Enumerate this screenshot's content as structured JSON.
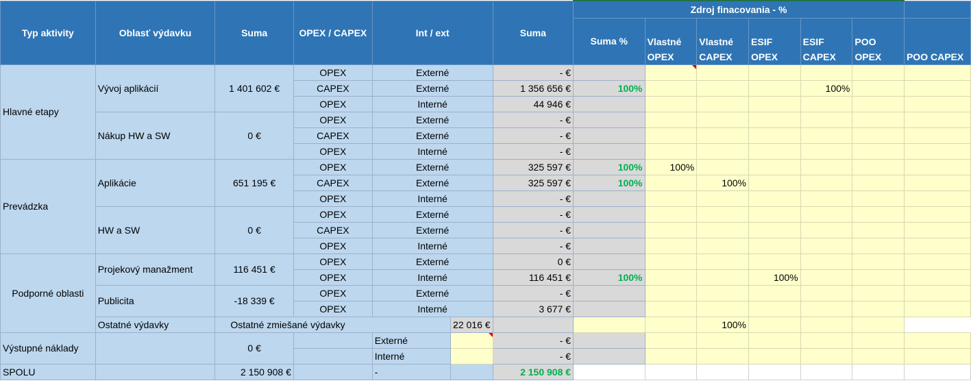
{
  "header": {
    "typ_aktivity": "Typ aktivity",
    "oblast_vydavku": "Oblasť výdavku",
    "suma": "Suma",
    "opex_capex": "OPEX / CAPEX",
    "int_ext": "Int / ext",
    "suma2": "Suma",
    "zdroj": "Zdroj finacovania - %",
    "suma_pct": "Suma %",
    "vlastne_opex": "Vlastné OPEX",
    "vlastne_capex": "Vlastné CAPEX",
    "esif_opex": "ESIF OPEX",
    "esif_capex": "ESIF CAPEX",
    "poo_opex": "POO OPEX",
    "poo_capex": "POO CAPEX"
  },
  "groups": {
    "hlavne": "Hlavné etapy",
    "prevadzka": "Prevádzka",
    "podporne": "Podporné oblasti",
    "vystupne": "Výstupné náklady",
    "spolu": "SPOLU"
  },
  "areas": {
    "vyvoj": "Vývoj aplikácií",
    "vyvoj_sum": "1 401 602 €",
    "nakup": "Nákup HW a SW",
    "nakup_sum": "0 €",
    "aplikacie": "Aplikácie",
    "aplikacie_sum": "651 195 €",
    "hwsw": "HW a SW",
    "hwsw_sum": "0 €",
    "projekt": "Projekový manažment",
    "projekt_sum": "116 451 €",
    "publicita": "Publicita",
    "publicita_sum": "-18 339 €",
    "ostatne": "Ostatné výdavky",
    "ostatne_mix": "Ostatné zmiešané výdavky",
    "ostatne_dash": "-",
    "ostatne_sum": "22 016 €",
    "ostatne_esif": "100%",
    "vystupne_sum": "0 €",
    "vyst_ext": "Externé",
    "vyst_int": "Interné",
    "vyst_ext_sum": "- €",
    "vyst_int_sum": "- €",
    "spolu_sum": "2 150 908 €",
    "spolu_dash": "-",
    "spolu_total": "2 150 908 €"
  },
  "rows": [
    {
      "type": "OPEX",
      "ie": "Externé",
      "suma": "- €",
      "pct": "",
      "vo": "",
      "vc": "",
      "eo": "",
      "ec": "",
      "po": "",
      "pc": ""
    },
    {
      "type": "CAPEX",
      "ie": "Externé",
      "suma": "1 356 656 €",
      "pct": "100%",
      "vo": "",
      "vc": "",
      "eo": "",
      "ec": "100%",
      "po": "",
      "pc": ""
    },
    {
      "type": "OPEX",
      "ie": "Interné",
      "suma": "44 946 €",
      "pct": "",
      "vo": "",
      "vc": "",
      "eo": "",
      "ec": "",
      "po": "",
      "pc": ""
    },
    {
      "type": "OPEX",
      "ie": "Externé",
      "suma": "- €",
      "pct": "",
      "vo": "",
      "vc": "",
      "eo": "",
      "ec": "",
      "po": "",
      "pc": ""
    },
    {
      "type": "CAPEX",
      "ie": "Externé",
      "suma": "- €",
      "pct": "",
      "vo": "",
      "vc": "",
      "eo": "",
      "ec": "",
      "po": "",
      "pc": ""
    },
    {
      "type": "OPEX",
      "ie": "Interné",
      "suma": "- €",
      "pct": "",
      "vo": "",
      "vc": "",
      "eo": "",
      "ec": "",
      "po": "",
      "pc": ""
    },
    {
      "type": "OPEX",
      "ie": "Externé",
      "suma": "325 597 €",
      "pct": "100%",
      "vo": "100%",
      "vc": "",
      "eo": "",
      "ec": "",
      "po": "",
      "pc": ""
    },
    {
      "type": "CAPEX",
      "ie": "Externé",
      "suma": "325 597 €",
      "pct": "100%",
      "vo": "",
      "vc": "100%",
      "eo": "",
      "ec": "",
      "po": "",
      "pc": ""
    },
    {
      "type": "OPEX",
      "ie": "Interné",
      "suma": "- €",
      "pct": "",
      "vo": "",
      "vc": "",
      "eo": "",
      "ec": "",
      "po": "",
      "pc": ""
    },
    {
      "type": "OPEX",
      "ie": "Externé",
      "suma": "- €",
      "pct": "",
      "vo": "",
      "vc": "",
      "eo": "",
      "ec": "",
      "po": "",
      "pc": ""
    },
    {
      "type": "CAPEX",
      "ie": "Externé",
      "suma": "- €",
      "pct": "",
      "vo": "",
      "vc": "",
      "eo": "",
      "ec": "",
      "po": "",
      "pc": ""
    },
    {
      "type": "OPEX",
      "ie": "Interné",
      "suma": "- €",
      "pct": "",
      "vo": "",
      "vc": "",
      "eo": "",
      "ec": "",
      "po": "",
      "pc": ""
    },
    {
      "type": "OPEX",
      "ie": "Externé",
      "suma": "0 €",
      "pct": "",
      "vo": "",
      "vc": "",
      "eo": "",
      "ec": "",
      "po": "",
      "pc": ""
    },
    {
      "type": "OPEX",
      "ie": "Interné",
      "suma": "116 451 €",
      "pct": "100%",
      "vo": "",
      "vc": "",
      "eo": "100%",
      "ec": "",
      "po": "",
      "pc": ""
    },
    {
      "type": "OPEX",
      "ie": "Externé",
      "suma": "- €",
      "pct": "",
      "vo": "",
      "vc": "",
      "eo": "",
      "ec": "",
      "po": "",
      "pc": ""
    },
    {
      "type": "OPEX",
      "ie": "Interné",
      "suma": "3 677 €",
      "pct": "",
      "vo": "",
      "vc": "",
      "eo": "",
      "ec": "",
      "po": "",
      "pc": ""
    }
  ],
  "colors": {
    "header_blue": "#2f75b5",
    "light_blue": "#bdd7ee",
    "gray": "#d9d9d9",
    "yellow": "#ffffcc",
    "green": "#00b050",
    "comment_red": "#e00000"
  }
}
